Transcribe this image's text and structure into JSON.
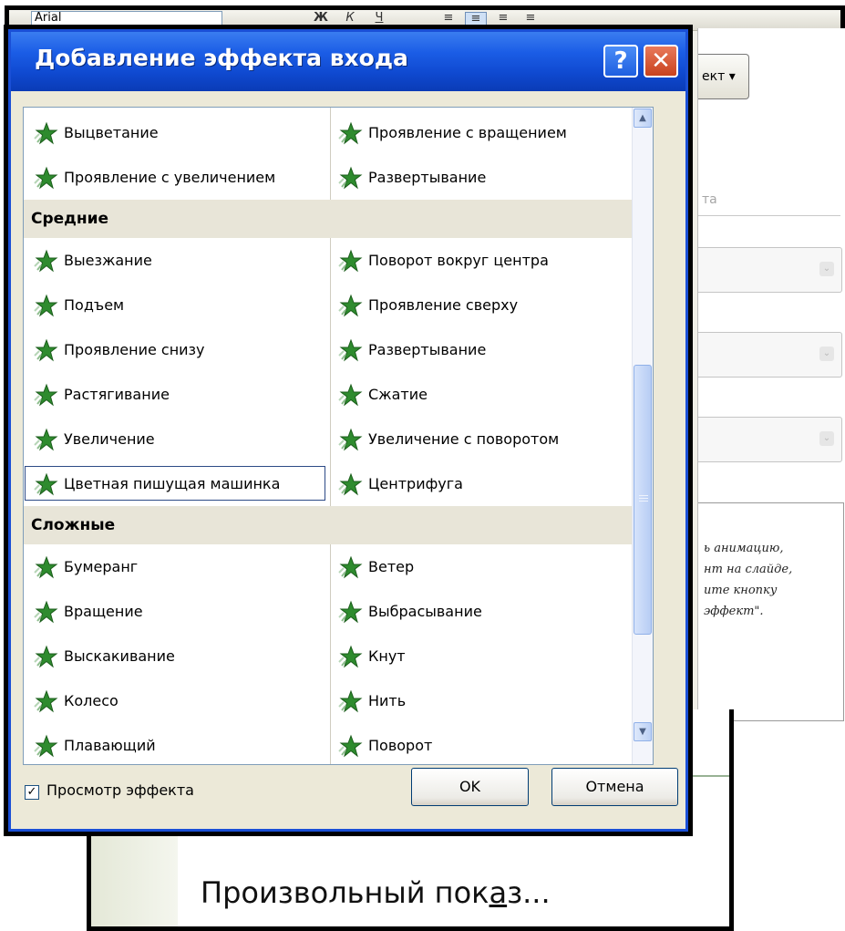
{
  "background": {
    "toolbar": {
      "font_name": "Arial",
      "buttons": [
        "Ж",
        "К",
        "Ч"
      ]
    },
    "taskpane": {
      "effect_button": "ект",
      "faded_label": "та",
      "hint_lines": [
        "ь анимацию,",
        "нт на слайде,",
        "ите кнопку",
        "эффект\"."
      ]
    },
    "bottom_menu": {
      "item_before": "Произвольный пок",
      "item_hotkey": "а",
      "item_after": "з..."
    }
  },
  "dialog": {
    "title": "Добавление эффекта входа",
    "help_glyph": "?",
    "close_glyph": "✕",
    "categories": [
      {
        "name": "",
        "rows": [
          [
            "Выцветание",
            "Проявление с вращением"
          ],
          [
            "Проявление с увеличением",
            "Развертывание"
          ]
        ]
      },
      {
        "name": "Средние",
        "rows": [
          [
            "Выезжание",
            "Поворот вокруг центра"
          ],
          [
            "Подъем",
            "Проявление сверху"
          ],
          [
            "Проявление снизу",
            "Развертывание"
          ],
          [
            "Растягивание",
            "Сжатие"
          ],
          [
            "Увеличение",
            "Увеличение с поворотом"
          ],
          [
            "Цветная пишущая машинка",
            "Центрифуга"
          ]
        ]
      },
      {
        "name": "Сложные",
        "rows": [
          [
            "Бумеранг",
            "Ветер"
          ],
          [
            "Вращение",
            "Выбрасывание"
          ],
          [
            "Выскакивание",
            "Кнут"
          ],
          [
            "Колесо",
            "Нить"
          ],
          [
            "Плавающий",
            "Поворот"
          ]
        ]
      }
    ],
    "selected_item": "Цветная пишущая машинка",
    "preview_checkbox": {
      "label": "Просмотр эффекта",
      "checked": true,
      "mark": "✓"
    },
    "ok_label": "OK",
    "cancel_label": "Отмена",
    "scroll": {
      "up": "▲",
      "down": "▼"
    }
  },
  "colors": {
    "title_bar": "#0f49d0",
    "star_green": "#2e8b2e",
    "category_bg": "#e8e5d8",
    "close_red": "#c9421d"
  },
  "icons": {
    "effect_icon": "green-star-icon"
  }
}
